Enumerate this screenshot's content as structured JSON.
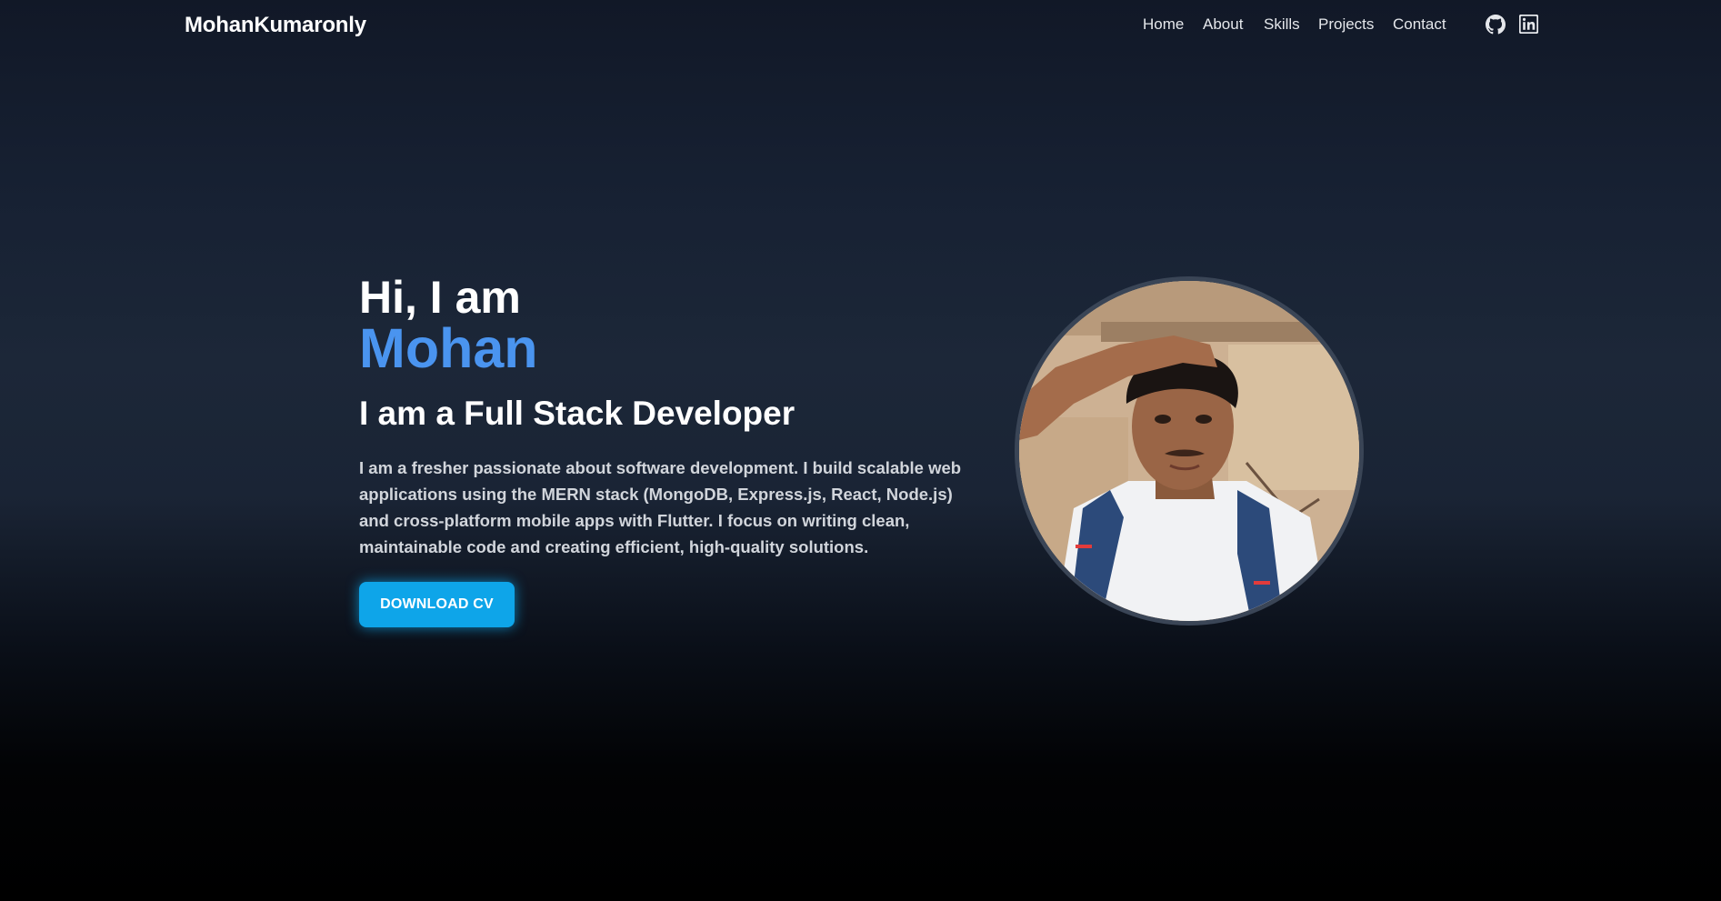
{
  "brand": "MohanKumaronly",
  "nav": {
    "links": [
      "Home",
      "About",
      "Skills",
      "Projects",
      "Contact"
    ],
    "icons": [
      "github-icon",
      "linkedin-icon"
    ]
  },
  "hero": {
    "greeting": "Hi, I am",
    "name": "Mohan",
    "role": "I am a Full Stack Developer",
    "description": "I am a fresher passionate about software development. I build scalable web applications using the MERN stack (MongoDB, Express.js, React, Node.js) and cross-platform mobile apps with Flutter. I focus on writing clean, maintainable code and creating efficient, high-quality solutions.",
    "cv_button": "DOWNLOAD CV"
  },
  "colors": {
    "accent_name": "#4a94ef",
    "button": "#0ea5e9",
    "background_top": "#111827",
    "background_bottom": "#000000"
  }
}
